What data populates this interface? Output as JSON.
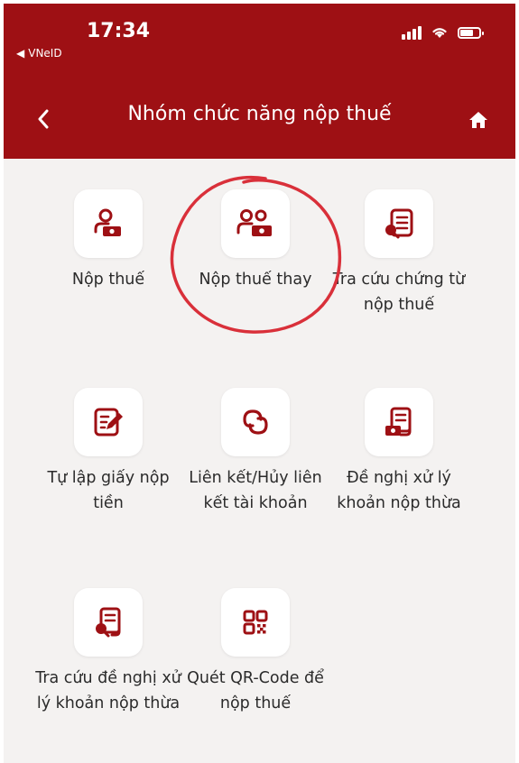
{
  "status": {
    "time": "17:34",
    "back_app": "VNeID"
  },
  "header": {
    "title": "Nhóm chức năng nộp thuế"
  },
  "items": [
    {
      "label": "Nộp thuế",
      "icon": "person-money-icon"
    },
    {
      "label": "Nộp thuế thay",
      "icon": "two-persons-money-icon"
    },
    {
      "label": "Tra cứu chứng từ nộp thuế",
      "icon": "document-search-icon"
    },
    {
      "label": "Tự lập giấy nộp tiền",
      "icon": "edit-form-icon"
    },
    {
      "label": "Liên kết/Hủy liên kết tài khoản",
      "icon": "link-icon"
    },
    {
      "label": "Đề nghị xử lý khoản nộp thừa",
      "icon": "document-money-icon"
    },
    {
      "label": "Tra cứu đề nghị xử lý khoản nộp thừa",
      "icon": "document-search-icon"
    },
    {
      "label": "Quét QR-Code để nộp thuế",
      "icon": "qr-code-icon"
    }
  ],
  "colors": {
    "brand": "#9e1014",
    "icon_dark": "#9e1014",
    "accent_circle": "#d9303a"
  }
}
